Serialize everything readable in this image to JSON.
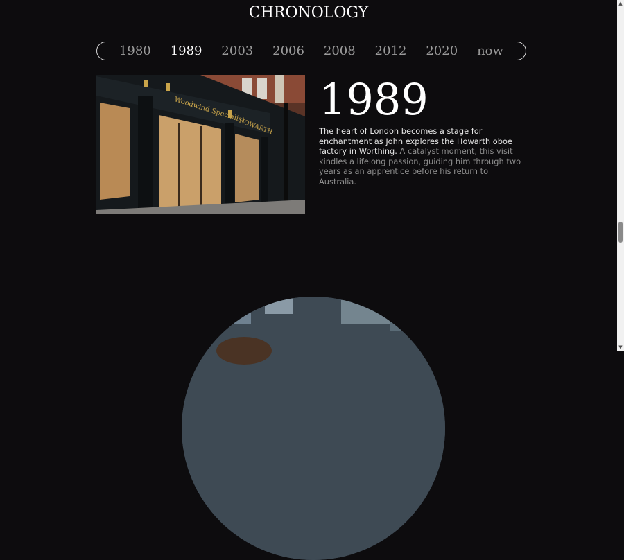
{
  "header": {
    "title": "CHRONOLOGY"
  },
  "timeline": {
    "years": [
      "1980",
      "1989",
      "2003",
      "2006",
      "2008",
      "2012",
      "2020",
      "now"
    ],
    "active": "1989"
  },
  "entry": {
    "year": "1989",
    "description_primary": "The heart of London becomes a stage for enchantment as John explores the Howarth oboe factory in Worthing.",
    "description_secondary": "A catalyst moment, this visit kindles a lifelong passion, guiding him through two years as an apprentice before his return to Australia.",
    "photo_signage": [
      "Woodwind Specialist",
      "HOWARTH"
    ]
  },
  "colors": {
    "background": "#0d0c0e",
    "text_active": "#ffffff",
    "text_inactive": "#9a9a9a"
  }
}
